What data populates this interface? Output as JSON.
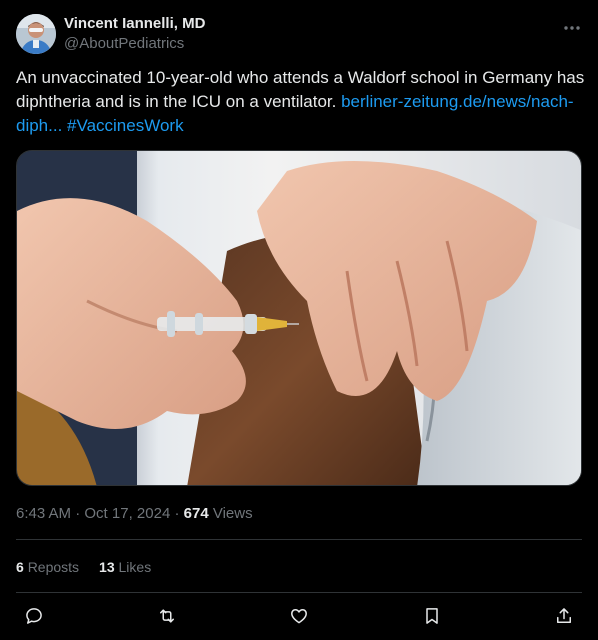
{
  "author": {
    "display_name": "Vincent Iannelli, MD",
    "handle": "@AboutPediatrics"
  },
  "tweet": {
    "text": "An unvaccinated 10-year-old who attends a Waldorf school in Germany has diphtheria and is in the ICU on a ventilator. ",
    "link_text": "berliner-zeitung.de/news/nach-diph...",
    "hashtag": "#VaccinesWork"
  },
  "meta": {
    "time": "6:43 AM",
    "separator": "·",
    "date": "Oct 17, 2024",
    "views_count": "674",
    "views_label": "Views"
  },
  "stats": {
    "reposts_count": "6",
    "reposts_label": "Reposts",
    "likes_count": "13",
    "likes_label": "Likes"
  },
  "colors": {
    "background": "#000000",
    "text": "#e7e9ea",
    "secondary": "#71767b",
    "link": "#1d9bf0",
    "border": "#2f3336"
  },
  "icons": {
    "more": "more-dots-icon",
    "reply": "reply-icon",
    "repost": "repost-icon",
    "like": "heart-icon",
    "bookmark": "bookmark-icon",
    "share": "share-icon"
  }
}
